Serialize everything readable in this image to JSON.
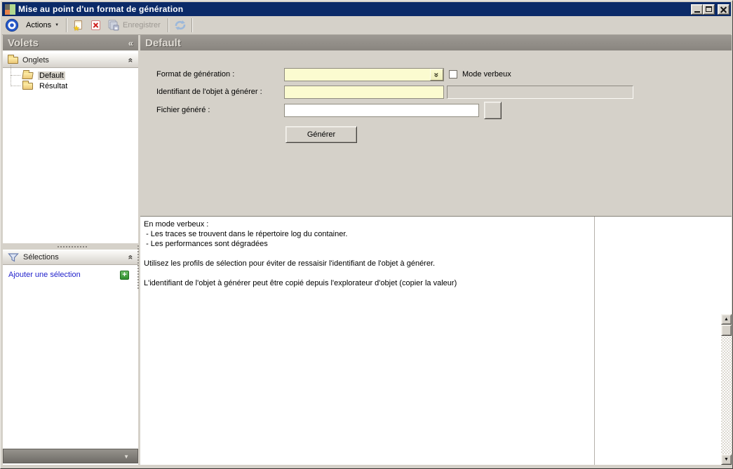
{
  "window": {
    "title": "Mise au point d'un format de génération"
  },
  "toolbar": {
    "actions_label": "Actions",
    "save_label": "Enregistrer"
  },
  "sidebar": {
    "panel_title": "Volets",
    "groups": [
      {
        "title": "Onglets",
        "items": [
          {
            "label": "Default",
            "selected": true
          },
          {
            "label": "Résultat",
            "selected": false
          }
        ]
      },
      {
        "title": "Sélections",
        "add_link": "Ajouter une sélection"
      }
    ]
  },
  "main": {
    "panel_title": "Default",
    "form": {
      "format_label": "Format de génération :",
      "format_value": "",
      "mode_verbeux_label": "Mode verbeux",
      "mode_verbeux_checked": false,
      "identifiant_label": "Identifiant de l'objet à générer :",
      "identifiant_value": "",
      "identifiant_readonly_value": "",
      "fichier_label": "Fichier généré :",
      "fichier_value": "",
      "generer_label": "Générer"
    },
    "help": {
      "lines": [
        "En mode verbeux :",
        " - Les traces se trouvent dans le répertoire log du container.",
        " - Les performances sont dégradées"
      ],
      "para2": "Utilisez les profils de sélection pour éviter de ressaisir l'identifiant de l'objet à générer.",
      "para3": "L'identifiant de l'objet à générer peut être copié depuis l'explorateur d'objet (copier la valeur)"
    }
  },
  "glyphs": {
    "chevrons_left": "«",
    "chevrons_right": "»",
    "caret_down": "▼",
    "scroll_up": "▲",
    "scroll_down": "▼",
    "plus": "+",
    "star": "★"
  },
  "colors": {
    "titlebar": "#0b2a68",
    "chrome": "#d5d1c9",
    "panel_header": "#918d87",
    "field_yellow": "#fbfbd0",
    "link_blue": "#2222cc"
  }
}
